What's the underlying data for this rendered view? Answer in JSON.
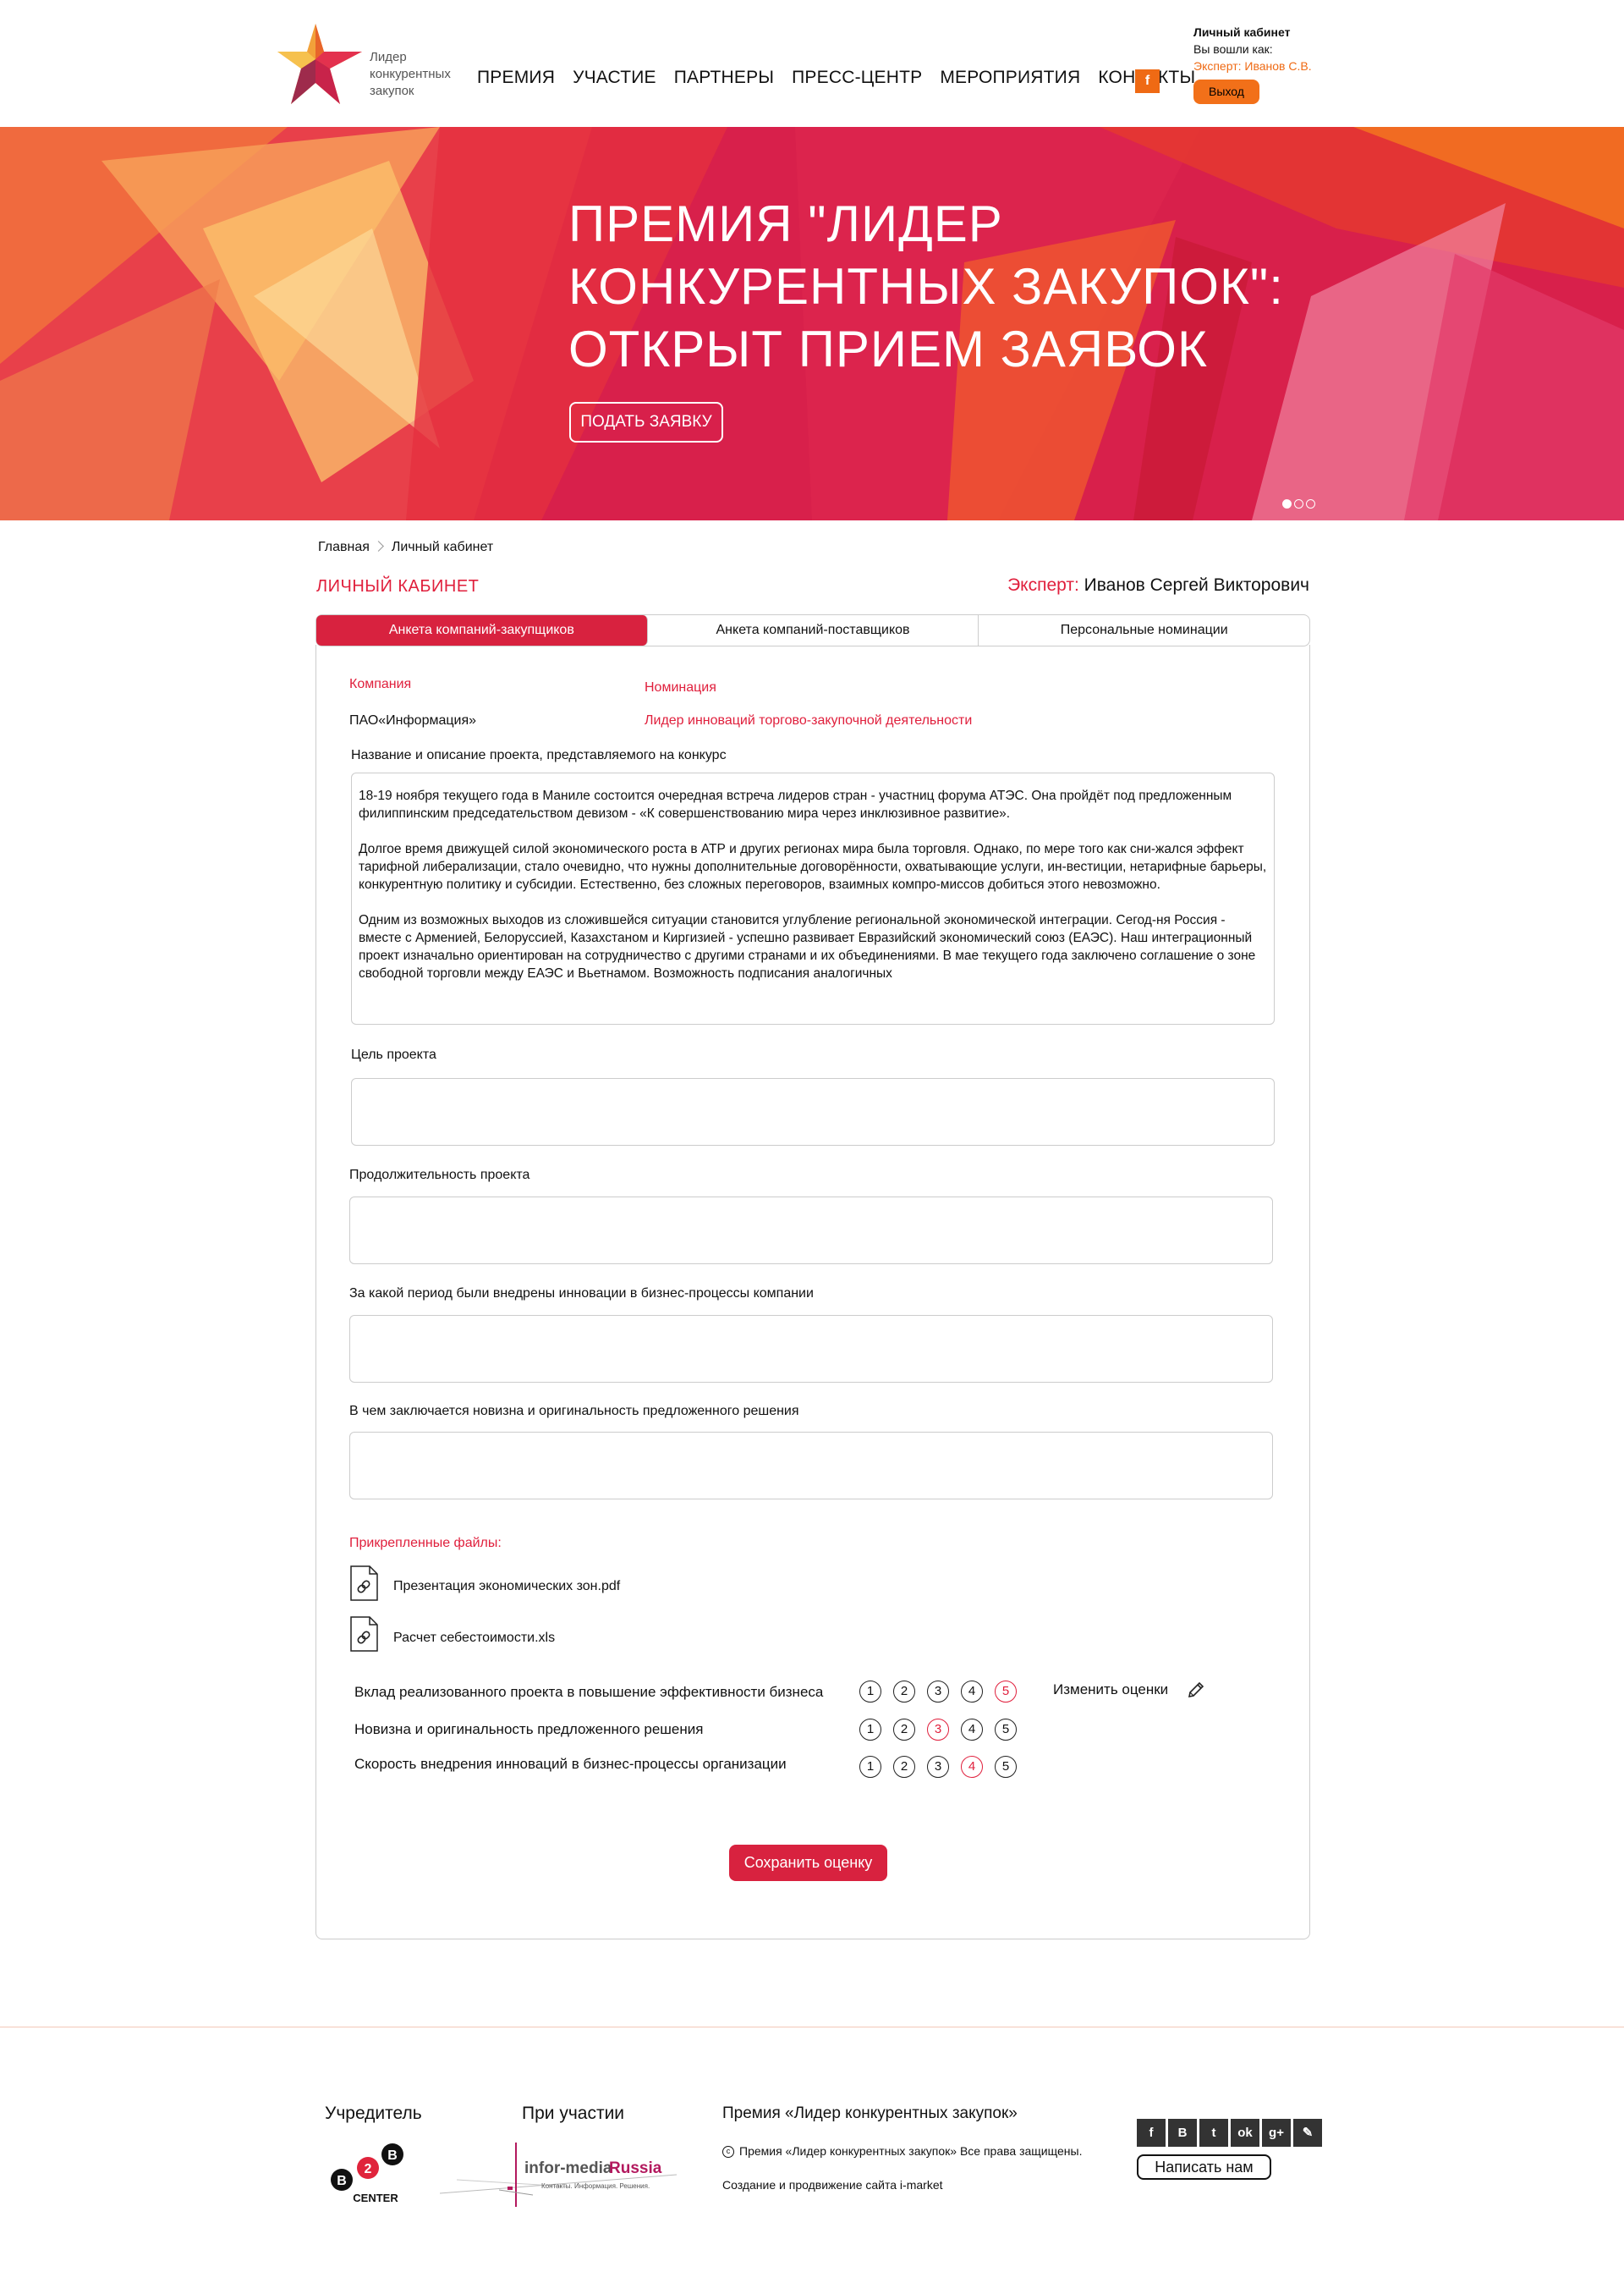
{
  "header": {
    "logo_text": "Лидер конкурентных закупок",
    "nav": [
      "ПРЕМИЯ",
      "УЧАСТИЕ",
      "ПАРТНЕРЫ",
      "ПРЕСС-ЦЕНТР",
      "МЕРОПРИЯТИЯ",
      "КОНТАКТЫ"
    ],
    "fb_label": "f",
    "account_title": "Личный кабинет",
    "logged_as": "Вы вошли как:",
    "user": "Эксперт: Иванов С.В.",
    "logout": "Выход"
  },
  "banner": {
    "title_line1": "ПРЕМИЯ \"ЛИДЕР",
    "title_line2": "КОНКУРЕНТНЫХ ЗАКУПОК\":",
    "title_line3": "ОТКРЫТ ПРИЕМ ЗАЯВОК",
    "button": "ПОДАТЬ ЗАЯВКУ",
    "slides": 3,
    "active_slide": 1
  },
  "breadcrumb": {
    "home": "Главная",
    "current": "Личный кабинет"
  },
  "page_title": "ЛИЧНЫЙ КАБИНЕТ",
  "expert": {
    "label": "Эксперт:",
    "name": "Иванов Сергей Викторович"
  },
  "tabs": [
    "Анкета компаний-закупщиков",
    "Анкета компаний-поставщиков",
    "Персональные номинации"
  ],
  "form": {
    "company_label": "Компания",
    "company_value": "ПАО«Информация»",
    "nomination_label": "Номинация",
    "nomination_value": "Лидер инноваций торгово-закупочной деятельности",
    "project_label": "Название и описание проекта, представляемого на конкурс",
    "project_text": [
      "18-19 ноября текущего года в Маниле состоится очередная встреча лидеров стран - участниц форума АТЭС. Она пройдёт под предложенным филиппинским председательством девизом - «К совершенствованию мира через инклюзивное развитие».",
      "Долгое время движущей силой экономического роста в АТР и других регионах мира была торговля. Однако, по мере того как сни-жался эффект тарифной либерализации, стало очевидно, что нужны дополнительные договорённости, охватывающие услуги, ин-вестиции, нетарифные барьеры, конкурентную политику и субсидии. Естественно, без сложных переговоров, взаимных компро-миссов добиться этого невозможно.",
      "Одним из возможных выходов из сложившейся ситуации становится углубление региональной экономической интеграции. Сегод-ня Россия - вместе с Арменией, Белоруссией, Казахстаном и Киргизией - успешно развивает Евразийский экономический союз (ЕАЭС). Наш интеграционный проект изначально ориентирован на сотрудничество с другими странами и их объединениями. В мае текущего года заключено соглашение о зоне свободной торговли между ЕАЭС и Вьетнамом. Возможность подписания аналогичных"
    ],
    "goal_label": "Цель проекта",
    "duration_label": "Продолжительность проекта",
    "period_label": "За какой период были внедрены инновации в бизнес-процессы компании",
    "novelty_label": "В чем заключается новизна и оригинальность предложенного решения",
    "files_label": "Прикрепленные файлы:",
    "files": [
      "Презентация экономических зон.pdf",
      "Расчет себестоимости.xls"
    ],
    "ratings": [
      {
        "label": "Вклад реализованного проекта в повышение эффективности бизнеса",
        "selected": 5
      },
      {
        "label": "Новизна и оригинальность предложенного решения",
        "selected": 3
      },
      {
        "label": "Скорость внедрения инноваций в бизнес-процессы организации",
        "selected": 4
      }
    ],
    "scale": [
      "1",
      "2",
      "3",
      "4",
      "5"
    ],
    "edit_label": "Изменить оценки",
    "save": "Сохранить оценку"
  },
  "footer": {
    "founder": "Учредитель",
    "participation": "При участии",
    "award": "Премия «Лидер конкурентных закупок»",
    "copyright": "Премия «Лидер конкурентных закупок» Все права защищены.",
    "made_by": "Создание и продвижение сайта i-market",
    "b2b_letters": [
      "B",
      "2",
      "B"
    ],
    "b2b_word": "CENTER",
    "infomedia_name": "infor-media",
    "infomedia_country": "Russia",
    "infomedia_slogan": "Контакты. Информация. Решения.",
    "socials": [
      "f",
      "B",
      "t",
      "ok",
      "g+",
      "✎"
    ],
    "write_us": "Написать нам"
  },
  "colors": {
    "accent": "#d8223f",
    "orange": "#ef6a14"
  }
}
